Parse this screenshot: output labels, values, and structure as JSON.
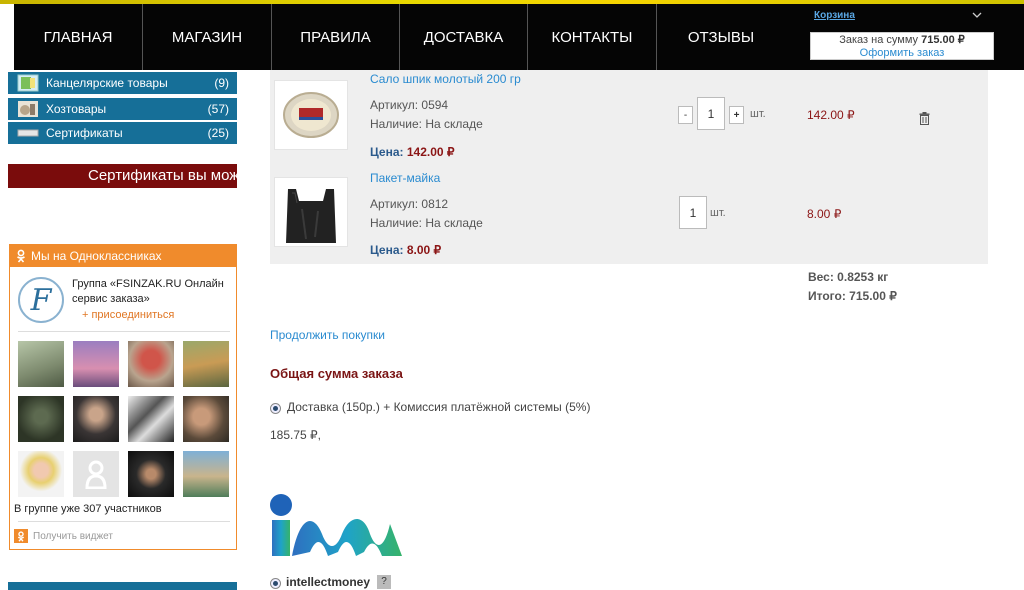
{
  "nav": {
    "items": [
      "Главная",
      "Магазин",
      "Правила",
      "Доставка",
      "Контакты",
      "Отзывы"
    ]
  },
  "cart": {
    "title": "Корзина",
    "chevron": "chevron-down-icon",
    "summary_label": "Заказ на сумму",
    "summary_value": "715.00 ₽",
    "checkout_link": "Оформить заказ"
  },
  "sidebar": {
    "categories": [
      {
        "label": "Канцелярские товары",
        "count": "(9)",
        "icon": "stationery-icon"
      },
      {
        "label": "Хозтовары",
        "count": "(57)",
        "icon": "household-icon"
      },
      {
        "label": "Сертификаты",
        "count": "(25)",
        "icon": "certificate-icon"
      }
    ],
    "banner": "Сертификаты вы можете приобрести"
  },
  "ok_widget": {
    "header": "Мы на Одноклассниках",
    "group_name": "Группа «FSINZAK.RU Онлайн сервис заказа»",
    "join_label": "+ присоединиться",
    "members_text": "В группе уже 307 участников",
    "get_widget": "Получить виджет"
  },
  "items": [
    {
      "title": "Сало шпик молотый 200 гр",
      "article": "Артикул: 0594",
      "stock": "Наличие: На складе",
      "price_label": "Цена:",
      "price": "142.00 ₽",
      "qty": "1",
      "unit": "шт.",
      "sum": "142.00 ₽"
    },
    {
      "title": "Пакет-майка",
      "article": "Артикул: 0812",
      "stock": "Наличие: На складе",
      "price_label": "Цена:",
      "price": "8.00 ₽",
      "qty": "1",
      "unit": "шт.",
      "sum": "8.00 ₽"
    }
  ],
  "totals": {
    "weight": "Вес: 0.8253 кг",
    "total": "Итого: 715.00 ₽"
  },
  "continue_link": "Продолжить покупки",
  "order_title": "Общая сумма заказа",
  "delivery_option": "Доставка (150р.) + Комиссия платёжной системы (5%)",
  "delivery_sum": "185.75 ₽,",
  "payment": {
    "name": "intellectmoney",
    "help": "?"
  },
  "colors": {
    "nav_bg": "#050505",
    "sidebar_blue": "#166f98",
    "ok_orange": "#f08b2c",
    "price_red": "#8b1515",
    "link_blue": "#2a8bd0"
  }
}
